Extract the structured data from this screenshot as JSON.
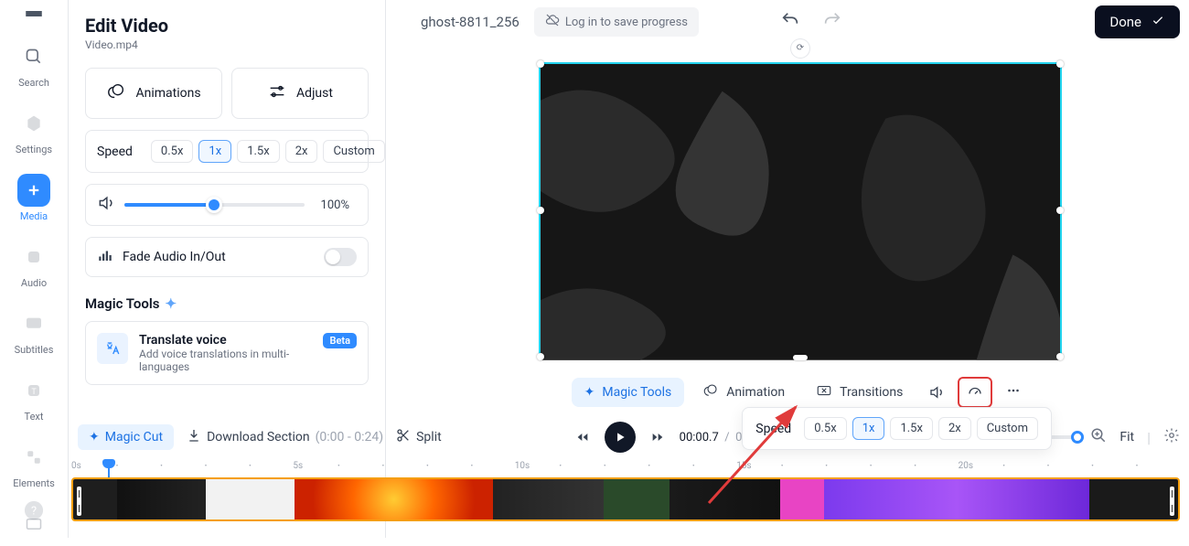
{
  "sidebar": {
    "items": [
      {
        "key": "search",
        "label": "Search"
      },
      {
        "key": "settings",
        "label": "Settings"
      },
      {
        "key": "media",
        "label": "Media"
      },
      {
        "key": "audio",
        "label": "Audio"
      },
      {
        "key": "subtitles",
        "label": "Subtitles"
      },
      {
        "key": "text",
        "label": "Text"
      },
      {
        "key": "elements",
        "label": "Elements"
      }
    ]
  },
  "panel": {
    "title": "Edit Video",
    "subtitle": "Video.mp4",
    "animations_label": "Animations",
    "adjust_label": "Adjust",
    "speed_label": "Speed",
    "speed_options": [
      "0.5x",
      "1x",
      "1.5x",
      "2x",
      "Custom"
    ],
    "speed_active_index": 1,
    "volume_pct": "100%",
    "fade_label": "Fade Audio In/Out",
    "magic_section": "Magic Tools",
    "translate_title": "Translate voice",
    "translate_desc": "Add voice translations in multi-languages",
    "beta_label": "Beta"
  },
  "topbar": {
    "filename": "ghost-8811_256",
    "login_label": "Log in to save progress",
    "done_label": "Done"
  },
  "bottom_toolbar": {
    "magic_tools": "Magic Tools",
    "animation": "Animation",
    "transitions": "Transitions"
  },
  "popover": {
    "label": "Speed",
    "options": [
      "0.5x",
      "1x",
      "1.5x",
      "2x",
      "Custom"
    ],
    "active_index": 1
  },
  "toolrow": {
    "magic_cut": "Magic Cut",
    "download": "Download Section",
    "download_range": "(0:00 - 0:24)",
    "split": "Split",
    "time_current": "00:00.7",
    "time_sep": "/",
    "time_total": "00",
    "fit_label": "Fit"
  },
  "timeline": {
    "ticks": [
      "0s",
      "5s",
      "10s",
      "15s",
      "20s"
    ]
  }
}
